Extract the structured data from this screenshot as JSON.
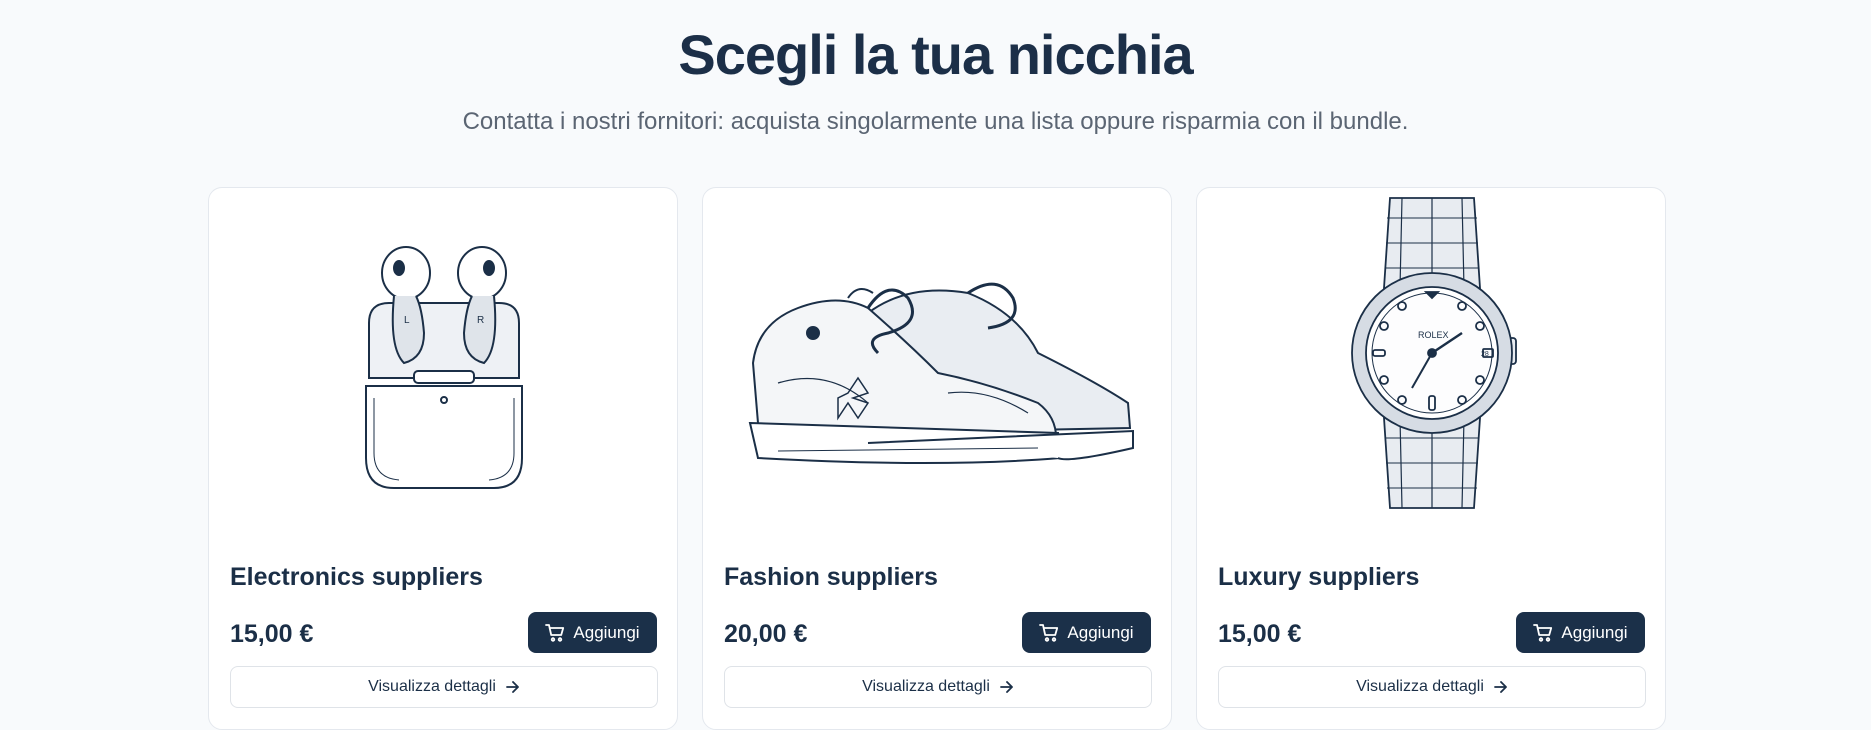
{
  "header": {
    "title": "Scegli la tua nicchia",
    "subtitle": "Contatta i nostri fornitori: acquista singolarmente una lista oppure risparmia con il bundle."
  },
  "cards": [
    {
      "title": "Electronics suppliers",
      "price": "15,00 €",
      "add_label": "Aggiungi",
      "details_label": "Visualizza dettagli",
      "image": "earbuds-illustration"
    },
    {
      "title": "Fashion suppliers",
      "price": "20,00 €",
      "add_label": "Aggiungi",
      "details_label": "Visualizza dettagli",
      "image": "sneakers-illustration"
    },
    {
      "title": "Luxury suppliers",
      "price": "15,00 €",
      "add_label": "Aggiungi",
      "details_label": "Visualizza dettagli",
      "image": "watch-illustration"
    }
  ],
  "illustration_text": {
    "earbud_left": "L",
    "earbud_right": "R",
    "watch_brand": "ROLEX",
    "watch_date": "28"
  },
  "icons": {
    "cart": "cart-icon",
    "arrow": "arrow-right-icon"
  },
  "colors": {
    "primary": "#1b3049",
    "background": "#f8fafc"
  }
}
